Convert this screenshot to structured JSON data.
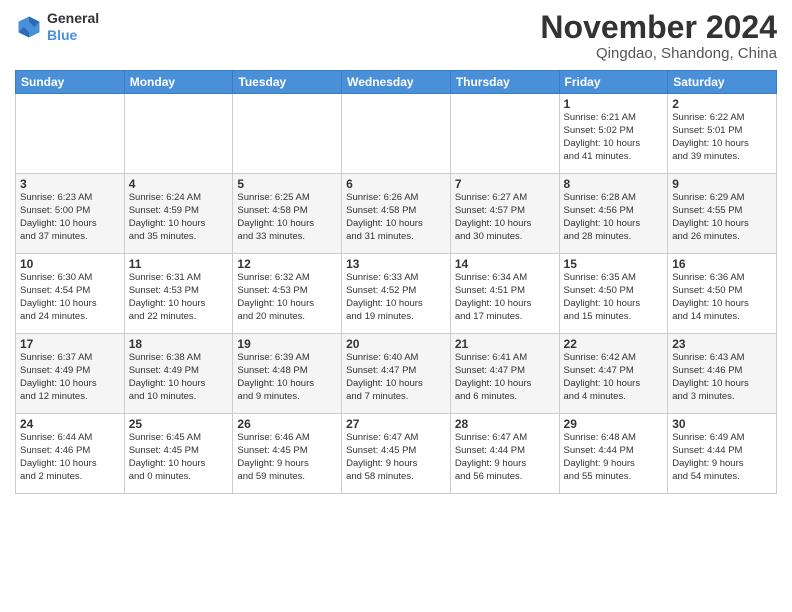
{
  "logo": {
    "general": "General",
    "blue": "Blue"
  },
  "header": {
    "month": "November 2024",
    "location": "Qingdao, Shandong, China"
  },
  "weekdays": [
    "Sunday",
    "Monday",
    "Tuesday",
    "Wednesday",
    "Thursday",
    "Friday",
    "Saturday"
  ],
  "weeks": [
    [
      {
        "day": "",
        "info": ""
      },
      {
        "day": "",
        "info": ""
      },
      {
        "day": "",
        "info": ""
      },
      {
        "day": "",
        "info": ""
      },
      {
        "day": "",
        "info": ""
      },
      {
        "day": "1",
        "info": "Sunrise: 6:21 AM\nSunset: 5:02 PM\nDaylight: 10 hours\nand 41 minutes."
      },
      {
        "day": "2",
        "info": "Sunrise: 6:22 AM\nSunset: 5:01 PM\nDaylight: 10 hours\nand 39 minutes."
      }
    ],
    [
      {
        "day": "3",
        "info": "Sunrise: 6:23 AM\nSunset: 5:00 PM\nDaylight: 10 hours\nand 37 minutes."
      },
      {
        "day": "4",
        "info": "Sunrise: 6:24 AM\nSunset: 4:59 PM\nDaylight: 10 hours\nand 35 minutes."
      },
      {
        "day": "5",
        "info": "Sunrise: 6:25 AM\nSunset: 4:58 PM\nDaylight: 10 hours\nand 33 minutes."
      },
      {
        "day": "6",
        "info": "Sunrise: 6:26 AM\nSunset: 4:58 PM\nDaylight: 10 hours\nand 31 minutes."
      },
      {
        "day": "7",
        "info": "Sunrise: 6:27 AM\nSunset: 4:57 PM\nDaylight: 10 hours\nand 30 minutes."
      },
      {
        "day": "8",
        "info": "Sunrise: 6:28 AM\nSunset: 4:56 PM\nDaylight: 10 hours\nand 28 minutes."
      },
      {
        "day": "9",
        "info": "Sunrise: 6:29 AM\nSunset: 4:55 PM\nDaylight: 10 hours\nand 26 minutes."
      }
    ],
    [
      {
        "day": "10",
        "info": "Sunrise: 6:30 AM\nSunset: 4:54 PM\nDaylight: 10 hours\nand 24 minutes."
      },
      {
        "day": "11",
        "info": "Sunrise: 6:31 AM\nSunset: 4:53 PM\nDaylight: 10 hours\nand 22 minutes."
      },
      {
        "day": "12",
        "info": "Sunrise: 6:32 AM\nSunset: 4:53 PM\nDaylight: 10 hours\nand 20 minutes."
      },
      {
        "day": "13",
        "info": "Sunrise: 6:33 AM\nSunset: 4:52 PM\nDaylight: 10 hours\nand 19 minutes."
      },
      {
        "day": "14",
        "info": "Sunrise: 6:34 AM\nSunset: 4:51 PM\nDaylight: 10 hours\nand 17 minutes."
      },
      {
        "day": "15",
        "info": "Sunrise: 6:35 AM\nSunset: 4:50 PM\nDaylight: 10 hours\nand 15 minutes."
      },
      {
        "day": "16",
        "info": "Sunrise: 6:36 AM\nSunset: 4:50 PM\nDaylight: 10 hours\nand 14 minutes."
      }
    ],
    [
      {
        "day": "17",
        "info": "Sunrise: 6:37 AM\nSunset: 4:49 PM\nDaylight: 10 hours\nand 12 minutes."
      },
      {
        "day": "18",
        "info": "Sunrise: 6:38 AM\nSunset: 4:49 PM\nDaylight: 10 hours\nand 10 minutes."
      },
      {
        "day": "19",
        "info": "Sunrise: 6:39 AM\nSunset: 4:48 PM\nDaylight: 10 hours\nand 9 minutes."
      },
      {
        "day": "20",
        "info": "Sunrise: 6:40 AM\nSunset: 4:47 PM\nDaylight: 10 hours\nand 7 minutes."
      },
      {
        "day": "21",
        "info": "Sunrise: 6:41 AM\nSunset: 4:47 PM\nDaylight: 10 hours\nand 6 minutes."
      },
      {
        "day": "22",
        "info": "Sunrise: 6:42 AM\nSunset: 4:47 PM\nDaylight: 10 hours\nand 4 minutes."
      },
      {
        "day": "23",
        "info": "Sunrise: 6:43 AM\nSunset: 4:46 PM\nDaylight: 10 hours\nand 3 minutes."
      }
    ],
    [
      {
        "day": "24",
        "info": "Sunrise: 6:44 AM\nSunset: 4:46 PM\nDaylight: 10 hours\nand 2 minutes."
      },
      {
        "day": "25",
        "info": "Sunrise: 6:45 AM\nSunset: 4:45 PM\nDaylight: 10 hours\nand 0 minutes."
      },
      {
        "day": "26",
        "info": "Sunrise: 6:46 AM\nSunset: 4:45 PM\nDaylight: 9 hours\nand 59 minutes."
      },
      {
        "day": "27",
        "info": "Sunrise: 6:47 AM\nSunset: 4:45 PM\nDaylight: 9 hours\nand 58 minutes."
      },
      {
        "day": "28",
        "info": "Sunrise: 6:47 AM\nSunset: 4:44 PM\nDaylight: 9 hours\nand 56 minutes."
      },
      {
        "day": "29",
        "info": "Sunrise: 6:48 AM\nSunset: 4:44 PM\nDaylight: 9 hours\nand 55 minutes."
      },
      {
        "day": "30",
        "info": "Sunrise: 6:49 AM\nSunset: 4:44 PM\nDaylight: 9 hours\nand 54 minutes."
      }
    ]
  ]
}
